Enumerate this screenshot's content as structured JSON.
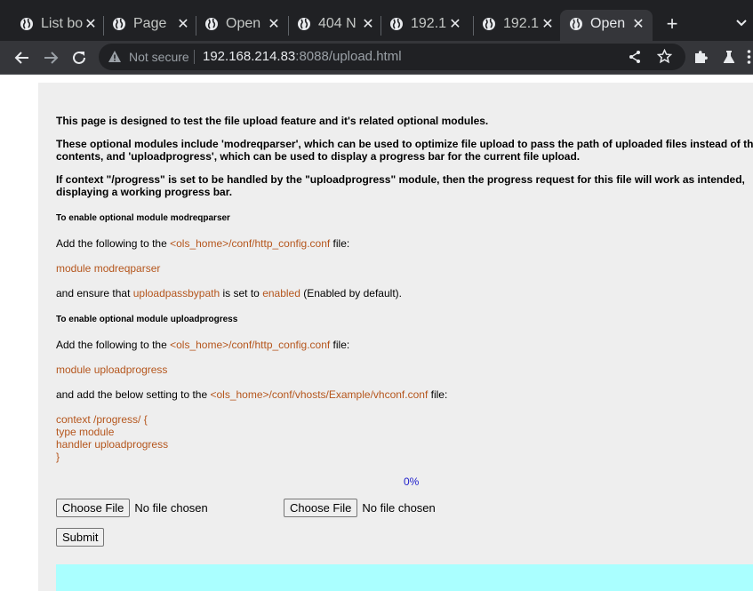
{
  "browser": {
    "tabs": [
      {
        "title": "List bo",
        "active": false
      },
      {
        "title": "Page",
        "active": false
      },
      {
        "title": "Open",
        "active": false
      },
      {
        "title": "404 N",
        "active": false
      },
      {
        "title": "192.1",
        "active": false
      },
      {
        "title": "192.1",
        "active": false
      },
      {
        "title": "Open",
        "active": true
      }
    ],
    "new_tab_label": "+",
    "security_label": "Not secure",
    "url_host": "192.168.214.83",
    "url_rest": ":8088/upload.html"
  },
  "page": {
    "intro1": "This page is designed to test the file upload feature and it's related optional modules.",
    "intro2a": "These optional modules include 'modreqparser', which can be used to optimize file upload to pass the path of uploaded files instead of the",
    "intro2b": "contents, and 'uploadprogress', which can be used to display a progress bar for the current file upload.",
    "intro3a": "If context \"/progress\" is set to be handled by the \"uploadprogress\" module, then the progress request for this file will work as intended,",
    "intro3b": "displaying a working progress bar.",
    "section1": {
      "heading": "To enable optional module modreqparser",
      "add_prefix": "Add the following to the ",
      "config_path": "<ols_home>/conf/http_config.conf",
      "add_suffix": " file:",
      "module_line": "module modreqparser",
      "ensure_prefix": "and ensure that ",
      "ensure_key": "uploadpassbypath",
      "ensure_mid": " is set to ",
      "ensure_value": "enabled",
      "ensure_suffix": " (Enabled by default)."
    },
    "section2": {
      "heading": "To enable optional module uploadprogress",
      "add_prefix": "Add the following to the ",
      "config_path": "<ols_home>/conf/http_config.conf",
      "add_suffix": " file:",
      "module_line": "module uploadprogress",
      "vh_prefix": "and add the below setting to the ",
      "vh_path": "<ols_home>/conf/vhosts/Example/vhconf.conf",
      "vh_suffix": " file:",
      "context_lines": [
        "context /progress/ {",
        "type module",
        "handler uploadprogress",
        "}"
      ]
    },
    "progress_percent": "0%",
    "file_inputs": [
      {
        "button": "Choose File",
        "status": "No file chosen"
      },
      {
        "button": "Choose File",
        "status": "No file chosen"
      }
    ],
    "submit_label": "Submit"
  },
  "colors": {
    "tabstrip_bg": "#202124",
    "toolbar_bg": "#35363a",
    "panel_bg": "#eeeeee",
    "code_text": "#b5561d",
    "percent_text": "#2222cc",
    "progress_area": "#aaffff"
  },
  "icons": {
    "tab_favicon": "globe-icon",
    "tab_close": "close-icon",
    "toolbar": [
      "back-arrow-icon",
      "forward-arrow-icon",
      "reload-icon",
      "warning-icon",
      "share-icon",
      "star-icon",
      "extensions-puzzle-icon",
      "flask-icon",
      "more-icon"
    ]
  }
}
